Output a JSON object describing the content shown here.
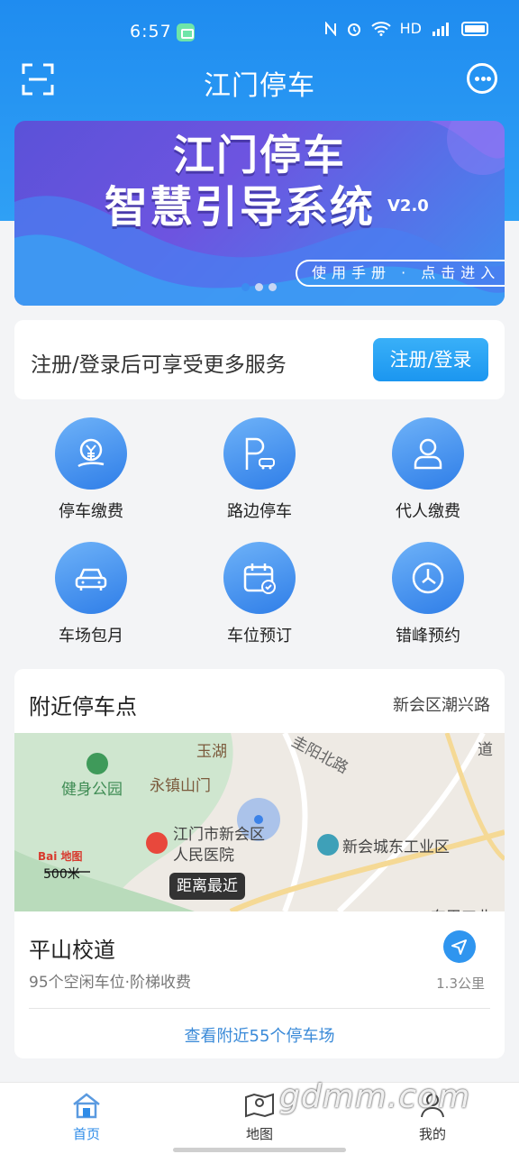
{
  "status_bar": {
    "time": "6:57",
    "network": "HD",
    "signal": "4G"
  },
  "header": {
    "title": "江门停车",
    "scan_icon": "scan-icon",
    "more_icon": "more-icon"
  },
  "banner": {
    "title": "江门停车",
    "subtitle": "智慧引导系统",
    "version": "V2.0",
    "cta": "使用手册 · 点击进入",
    "dots": 3,
    "active_dot": 0
  },
  "login": {
    "prompt": "注册/登录后可享受更多服务",
    "button": "注册/登录"
  },
  "services": [
    {
      "label": "停车缴费",
      "icon": "payment-icon"
    },
    {
      "label": "路边停车",
      "icon": "roadside-parking-icon"
    },
    {
      "label": "代人缴费",
      "icon": "person-icon"
    },
    {
      "label": "车场包月",
      "icon": "car-icon"
    },
    {
      "label": "车位预订",
      "icon": "calendar-icon"
    },
    {
      "label": "错峰预约",
      "icon": "clock-icon"
    }
  ],
  "nearby": {
    "title": "附近停车点",
    "location": "新会区潮兴路",
    "map": {
      "labels": {
        "yuhu": "玉湖",
        "road": "圭阳北路",
        "road_right": "道",
        "park": "健身公园",
        "mountain": "永镇山门",
        "hospital_line1": "江门市新会区",
        "hospital_line2": "人民医院",
        "industrial": "新会城东工业区",
        "industrial_partial": "东甲工业"
      },
      "scale": "500米",
      "logo": "Bai 地图",
      "nearest_tag": "距离最近"
    },
    "parking": {
      "name": "平山校道",
      "info": "95个空闲车位·阶梯收费",
      "distance": "1.3公里"
    },
    "view_all": "查看附近55个停车场"
  },
  "tabs": [
    {
      "label": "首页",
      "icon": "home-icon",
      "active": true
    },
    {
      "label": "地图",
      "icon": "map-icon",
      "active": false
    },
    {
      "label": "我的",
      "icon": "user-icon",
      "active": false
    }
  ],
  "watermark": "gdmm.com"
}
